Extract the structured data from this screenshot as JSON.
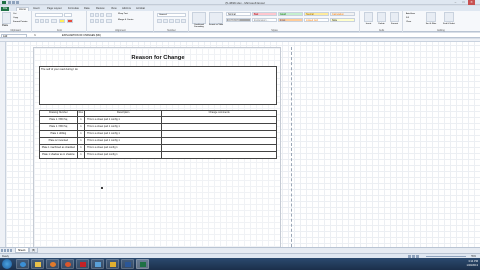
{
  "window": {
    "title": "(5-4699.xlsx - Microsoft Excel",
    "minimize": "–",
    "maximize": "□",
    "close": "✕"
  },
  "ribbon_tabs": [
    {
      "label": "File",
      "id": "file"
    },
    {
      "label": "Home",
      "id": "home"
    },
    {
      "label": "Insert",
      "id": "insert"
    },
    {
      "label": "Page Layout",
      "id": "page-layout"
    },
    {
      "label": "Formulas",
      "id": "formulas"
    },
    {
      "label": "Data",
      "id": "data"
    },
    {
      "label": "Review",
      "id": "review"
    },
    {
      "label": "View",
      "id": "view"
    },
    {
      "label": "Add-Ins",
      "id": "add-ins"
    },
    {
      "label": "Acrobat",
      "id": "acrobat"
    }
  ],
  "ribbon_groups": {
    "clipboard": "Clipboard",
    "font": "Font",
    "alignment": "Alignment",
    "number": "Number",
    "styles": "Styles",
    "cells": "Cells",
    "editing": "Editing"
  },
  "ribbon_controls": {
    "paste": "Paste",
    "cut": "Cut",
    "copy": "Copy",
    "format_painter": "Format Painter",
    "wrap_text": "Wrap Text",
    "merge_center": "Merge & Center",
    "number_format": "General",
    "conditional_formatting": "Conditional Formatting",
    "format_as_table": "Format as Table",
    "insert": "Insert",
    "delete": "Delete",
    "format": "Format",
    "autosum": "AutoSum",
    "fill": "Fill",
    "clear": "Clear",
    "sort_filter": "Sort & Filter",
    "find_select": "Find & Select"
  },
  "cell_styles": [
    {
      "label": "Normal",
      "bg": "#ffffff",
      "color": "#222222"
    },
    {
      "label": "Bad",
      "bg": "#ffc7ce",
      "color": "#9c0006"
    },
    {
      "label": "Good",
      "bg": "#c6efce",
      "color": "#006100"
    },
    {
      "label": "Neutral",
      "bg": "#ffeb9c",
      "color": "#9c6500"
    },
    {
      "label": "Calculation",
      "bg": "#f2f2f2",
      "color": "#fa7d00"
    },
    {
      "label": "Check Cell",
      "bg": "#a5a5a5",
      "color": "#ffffff"
    },
    {
      "label": "Explanatory...",
      "bg": "#ffffff",
      "color": "#7f7f7f"
    },
    {
      "label": "Input",
      "bg": "#ffcc99",
      "color": "#3f3f76"
    },
    {
      "label": "Linked Cell",
      "bg": "#ffffff",
      "color": "#fa7d00"
    },
    {
      "label": "Note",
      "bg": "#ffffcc",
      "color": "#222222"
    }
  ],
  "formula_bar": {
    "name_box": "A10",
    "fx": "fx",
    "value": "EXPLANATION OF CHANGES (MC)"
  },
  "report": {
    "title": "Reason for Change",
    "explain_text": "The self of your reed during I do",
    "table_headers": [
      "Drawing Number",
      "Rev",
      "Description",
      "Change comments"
    ],
    "rows": [
      {
        "drawing": "Plate 1 / 650 Sq",
        "rev": "1",
        "desc": "This is a sheet part 1 config 1",
        "comments": ""
      },
      {
        "drawing": "Plate 1 / 650 Sq",
        "rev": "1",
        "desc": "This is a sheet part 1 config 1",
        "comments": ""
      },
      {
        "drawing": "Plate 1 drilling",
        "rev": "1",
        "desc": "This is a sheet part 1 config 1",
        "comments": ""
      },
      {
        "drawing": "Plate w/ mounted",
        "rev": "1",
        "desc": "This is a sheet part 1 config 1",
        "comments": ""
      },
      {
        "drawing": "Plate 1 machined as shackled",
        "rev": "1",
        "desc": "This is a sheet part config 1",
        "comments": ""
      },
      {
        "drawing": "Plate 1 shadow as in shadow",
        "rev": "1",
        "desc": "This is a sheet part config 1",
        "comments": ""
      }
    ]
  },
  "sheet_tabs": [
    "Sheet1",
    "(5)"
  ],
  "status": {
    "ready": "Ready",
    "zoom": "55%"
  },
  "taskbar": {
    "icons": [
      "ie-icon",
      "folder-icon",
      "media-icon",
      "firefox-icon",
      "acrobat-icon",
      "email-icon",
      "outlook-icon",
      "word-icon",
      "excel-icon"
    ],
    "time": "3:14 PM",
    "date": "1/20/2013"
  }
}
